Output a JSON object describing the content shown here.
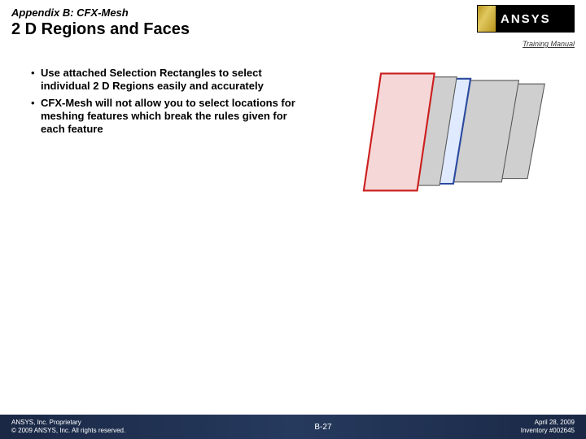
{
  "header": {
    "appendix": "Appendix B: CFX-Mesh",
    "title": "2 D Regions and Faces",
    "logo_text": "ANSYS",
    "training": "Training Manual"
  },
  "bullets": [
    "Use attached Selection Rectangles to select individual 2 D Regions easily and accurately",
    "CFX-Mesh will not allow you to select locations for meshing features which break the rules given for each feature"
  ],
  "footer": {
    "left1": "ANSYS, Inc. Proprietary",
    "left2": "© 2009 ANSYS, Inc. All rights reserved.",
    "center": "B-27",
    "right1": "April 28, 2009",
    "right2": "Inventory #002645"
  }
}
